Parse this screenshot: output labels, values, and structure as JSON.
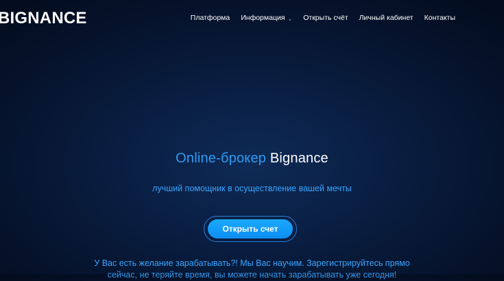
{
  "header": {
    "logo": "BIGNANCE",
    "nav": [
      {
        "label": "Платформа"
      },
      {
        "label": "Информация",
        "has_dropdown": true,
        "icon": "chevron-down-icon"
      },
      {
        "label": "Открыть счёт"
      },
      {
        "label": "Личный кабинет"
      },
      {
        "label": "Контакты"
      }
    ]
  },
  "hero": {
    "title_accent": "Online-брокер",
    "title_brand": "Bignance",
    "subtitle": "лучший помощник в осуществление вашей мечты",
    "cta_label": "Открыть счет",
    "text_line1": "У Вас есть желание зарабатывать?! Мы Вас научим. Зарегистрируйтесь прямо",
    "text_line2": "сейчас, не теряйте время, вы можете начать зарабатывать уже сегодня!"
  },
  "colors": {
    "background": "#0a1f44",
    "accent": "#2f9bf4",
    "button": "#1aa9ff",
    "text": "#ffffff"
  }
}
